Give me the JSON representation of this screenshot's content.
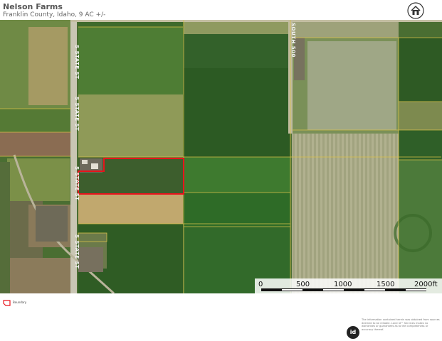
{
  "header": {
    "title": "Nelson Farms",
    "subtitle": "Franklin County, Idaho, 9 AC +/-"
  },
  "map": {
    "roads": [
      {
        "label": "S STATE ST"
      },
      {
        "label": "S STATE ST"
      },
      {
        "label": "S STATE ST"
      },
      {
        "label": "S STATE ST"
      },
      {
        "label": "SOUTH 500"
      }
    ],
    "scale_bar": {
      "ticks": [
        "0",
        "500",
        "1000",
        "1500",
        "2000ft"
      ]
    },
    "boundary_color": "#e8141c",
    "parcel_line_color": "#d8c24a"
  },
  "legend": {
    "label": "Boundary"
  },
  "footer": {
    "badge": "id",
    "disclaimer": "The information contained herein was obtained from sources deemed to be reliable. Land id™ Services makes no warranties or guarantees as to the completeness or accuracy thereof."
  },
  "colors": {
    "field_dark": "#2f5a22",
    "field_medium": "#4c7a34",
    "field_light": "#8b9a5a",
    "field_tan": "#b9a26c",
    "road": "#c9c6b4"
  }
}
